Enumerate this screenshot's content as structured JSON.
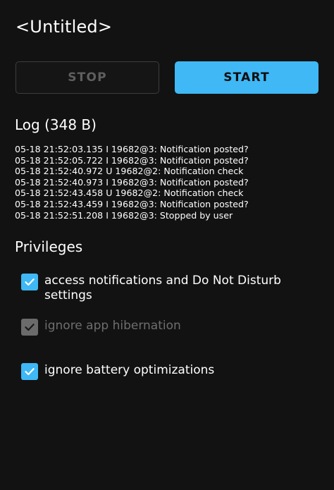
{
  "app": {
    "title": "<Untitled>"
  },
  "controls": {
    "stop_label": "STOP",
    "start_label": "START"
  },
  "log": {
    "title": "Log (348 B)",
    "lines": [
      "05-18 21:52:03.135 I 19682@3: Notification posted?",
      "05-18 21:52:05.722 I 19682@3: Notification posted?",
      "05-18 21:52:40.972 U 19682@2: Notification check",
      "05-18 21:52:40.973 I 19682@3: Notification posted?",
      "05-18 21:52:43.458 U 19682@2: Notification check",
      "05-18 21:52:43.459 I 19682@3: Notification posted?",
      "05-18 21:52:51.208 I 19682@3: Stopped by user"
    ]
  },
  "privileges": {
    "title": "Privileges",
    "items": [
      {
        "label": "access notifications and Do Not Disturb settings",
        "checked": true,
        "enabled": true
      },
      {
        "label": "ignore app hibernation",
        "checked": true,
        "enabled": false
      },
      {
        "label": "ignore battery optimizations",
        "checked": true,
        "enabled": true
      }
    ]
  },
  "colors": {
    "background": "#121212",
    "accent": "#3fb8f5",
    "disabled": "#6b6b6b"
  }
}
